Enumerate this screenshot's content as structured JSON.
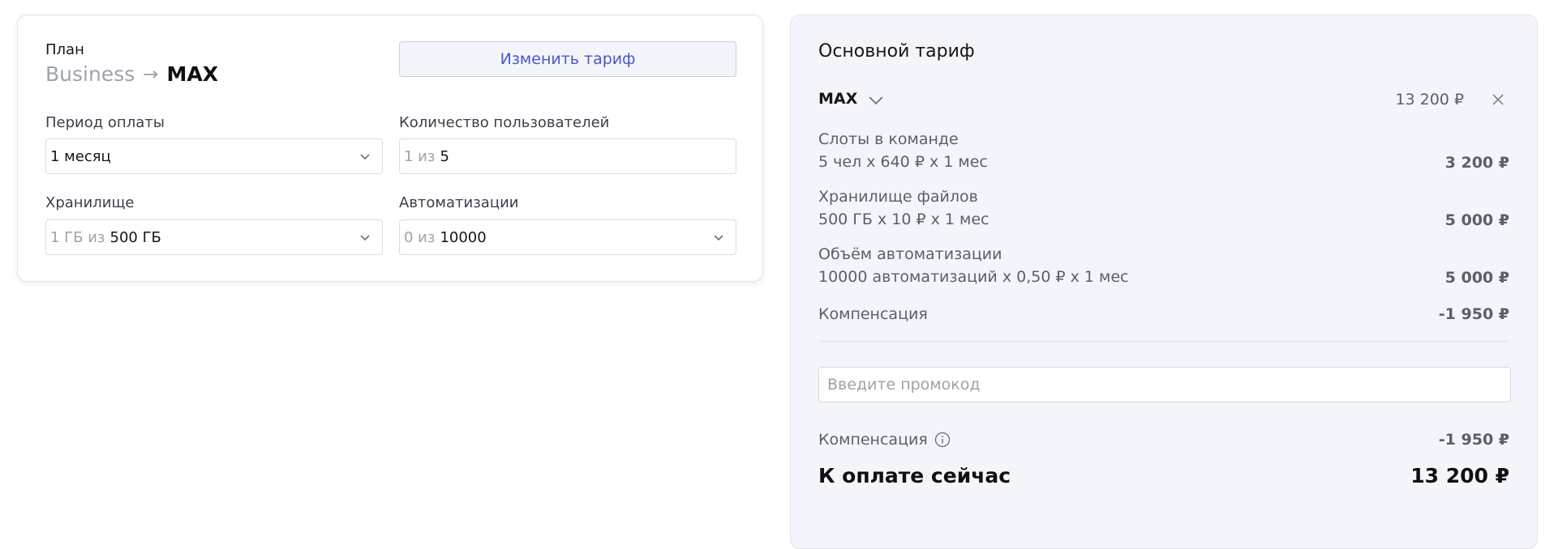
{
  "plan": {
    "label": "План",
    "from": "Business",
    "arrow": "→",
    "to": "MAX",
    "change_button": "Изменить тариф"
  },
  "fields": {
    "period": {
      "label": "Период оплаты",
      "value": "1 месяц"
    },
    "users": {
      "label": "Количество пользователей",
      "prefix": "1 из",
      "value": "5"
    },
    "storage": {
      "label": "Хранилище",
      "prefix": "1 ГБ из",
      "value": "500 ГБ"
    },
    "automations": {
      "label": "Автоматизации",
      "prefix": "0 из",
      "value": "10000"
    }
  },
  "summary": {
    "title": "Основной тариф",
    "tariff_name": "MAX",
    "tariff_price": "13 200 ₽",
    "items": [
      {
        "title": "Слоты в команде",
        "detail": "5 чел x 640 ₽ x 1 мес",
        "amount": "3 200 ₽"
      },
      {
        "title": "Хранилище файлов",
        "detail": "500 ГБ x 10 ₽ x 1 мес",
        "amount": "5 000 ₽"
      },
      {
        "title": "Объём автоматизации",
        "detail": "10000 автоматизаций x 0,50 ₽ x 1 мес",
        "amount": "5 000 ₽"
      },
      {
        "title": "Компенсация",
        "detail": "",
        "amount": "-1 950 ₽"
      }
    ],
    "promo_placeholder": "Введите промокод",
    "compensation_label": "Компенсация",
    "compensation_amount": "-1 950 ₽",
    "pay_label": "К оплате сейчас",
    "pay_amount": "13 200 ₽"
  },
  "colors": {
    "accent": "#4a58c9",
    "muted_text": "#9ea2ad",
    "panel_bg": "#f4f5fa"
  }
}
